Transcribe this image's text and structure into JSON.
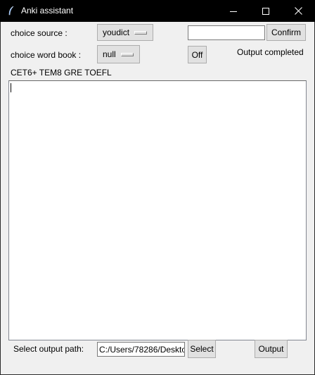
{
  "window": {
    "title": "Anki assistant",
    "icon": "feather-icon"
  },
  "controls": {
    "source_label": "choice source :",
    "source_value": "youdict",
    "wordbook_label": "choice word book :",
    "wordbook_value": "null",
    "word_entry_value": "",
    "confirm_label": "Confirm",
    "off_label": "Off",
    "status_text": "Output completed",
    "wordbook_list": "CET6+ TEM8 GRE TOEFL"
  },
  "output_area": {
    "text": ""
  },
  "footer": {
    "path_label": "Select output path:",
    "path_value": "C:/Users/78286/Deskto",
    "select_label": "Select",
    "output_label": "Output"
  }
}
